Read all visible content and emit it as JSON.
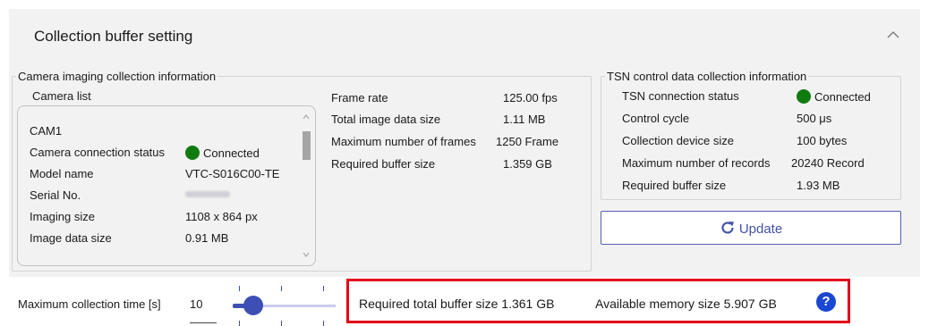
{
  "panel": {
    "title": "Collection buffer setting"
  },
  "camera_group": {
    "legend": "Camera imaging collection information",
    "list_label": "Camera list",
    "camera": {
      "name": "CAM1",
      "rows": [
        {
          "label": "Camera connection status",
          "value": "Connected",
          "status": "connected"
        },
        {
          "label": "Model name",
          "value": "VTC-S016C00-TE"
        },
        {
          "label": "Serial No.",
          "value": ""
        },
        {
          "label": "Imaging size",
          "value": "1108 x 864 px"
        },
        {
          "label": "Image data size",
          "value": "0.91 MB"
        }
      ]
    },
    "summary": [
      {
        "label": "Frame rate",
        "value": "125.00 fps"
      },
      {
        "label": "Total image data size",
        "value": "1.11 MB"
      },
      {
        "label": "Maximum number of frames",
        "value": "1250 Frame"
      },
      {
        "label": "Required buffer size",
        "value": "1.359 GB"
      }
    ]
  },
  "tsn_group": {
    "legend": "TSN control data collection information",
    "rows": [
      {
        "label": "TSN connection status",
        "value": "Connected",
        "status": "connected"
      },
      {
        "label": "Control cycle",
        "value": "500 μs"
      },
      {
        "label": "Collection device size",
        "value": "100 bytes"
      },
      {
        "label": "Maximum number of records",
        "value": "20240 Record"
      },
      {
        "label": "Required buffer size",
        "value": "1.93 MB"
      }
    ]
  },
  "update_button": {
    "label": "Update",
    "icon": "refresh-icon"
  },
  "collection_time": {
    "label": "Maximum collection time [s]",
    "value": "10",
    "slider_level": 0.2
  },
  "totals": {
    "required_text": "Required total buffer size 1.361 GB",
    "available_text": "Available memory size 5.907 GB",
    "help_glyph": "?"
  },
  "colors": {
    "connected": "#107c10",
    "accent": "#3d4fb5",
    "highlight": "#e2001a",
    "help": "#1947d1"
  }
}
